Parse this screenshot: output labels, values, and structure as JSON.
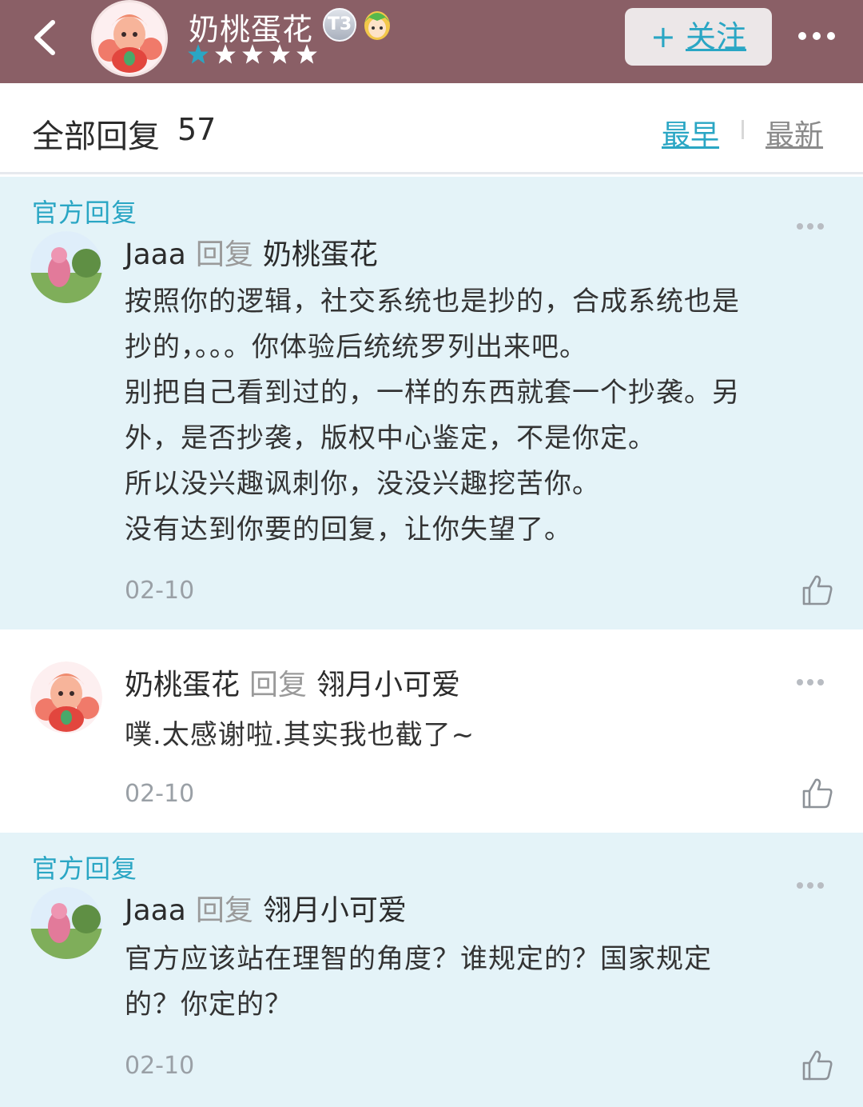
{
  "header": {
    "back_icon": "chevron-left-icon",
    "user_name": "奶桃蛋花",
    "badge_text": "T3",
    "stars_filled": 1,
    "stars_total": 5,
    "follow_plus": "+",
    "follow_label": "关注",
    "more_icon": "ellipsis-icon"
  },
  "sortbar": {
    "title": "全部回复",
    "count": "57",
    "earliest": "最早",
    "newest": "最新"
  },
  "comments": [
    {
      "official_tag": "官方回复",
      "author": "Jaaa",
      "reply_word": "回复",
      "target": "奶桃蛋花",
      "lines": [
        "按照你的逻辑，社交系统也是抄的，合成系统也是",
        "抄的，。。。你体验后统统罗列出来吧。",
        "别把自己看到过的，一样的东西就套一个抄袭。另",
        "外，是否抄袭，版权中心鉴定，不是你定。",
        "所以没兴趣讽刺你，没没兴趣挖苦你。",
        "没有达到你要的回复，让你失望了。"
      ],
      "date": "02-10"
    },
    {
      "official_tag": "",
      "author": "奶桃蛋花",
      "reply_word": "回复",
      "target": "翎月小可爱",
      "lines": [
        "噗.太感谢啦.其实我也截了~"
      ],
      "date": "02-10"
    },
    {
      "official_tag": "官方回复",
      "author": "Jaaa",
      "reply_word": "回复",
      "target": "翎月小可爱",
      "lines": [
        "官方应该站在理智的角度？谁规定的？国家规定",
        "的？你定的？"
      ],
      "date": "02-10"
    }
  ],
  "colors": {
    "header_bg": "#8a5f66",
    "accent": "#2aa6c4",
    "official_bg": "#e4f3f8"
  }
}
